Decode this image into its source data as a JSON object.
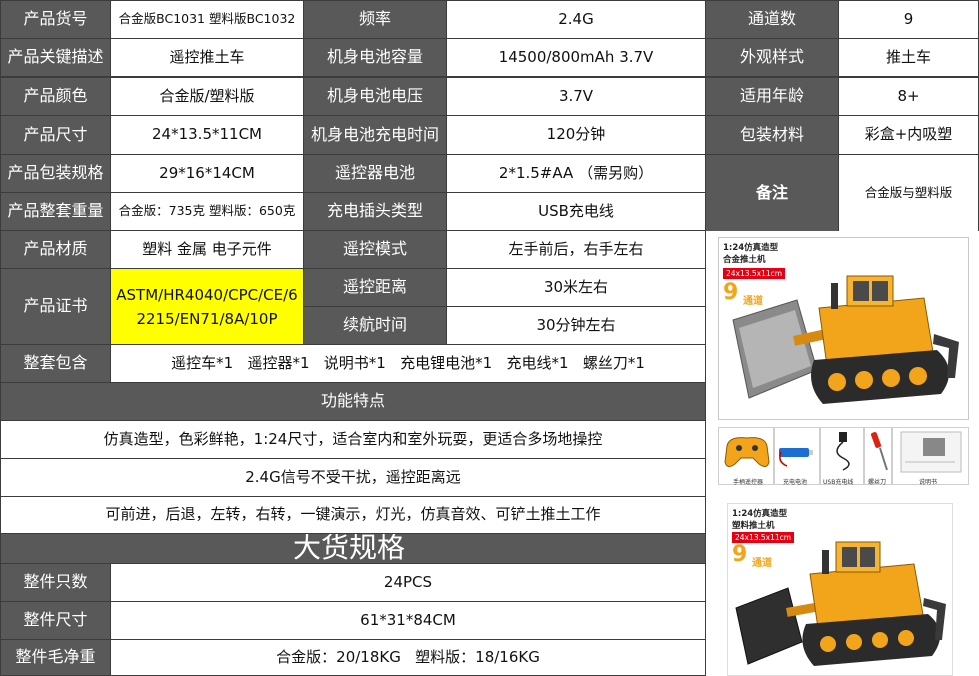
{
  "rows": {
    "r1": {
      "l1": "产品货号",
      "v1": "合金版BC1031  塑料版BC1032",
      "l2": "频率",
      "v2": "2.4G",
      "l3": "通道数",
      "v3": "9"
    },
    "r2": {
      "l1": "产品关键描述",
      "v1": "遥控推土车",
      "l2": "机身电池容量",
      "v2": "14500/800mAh 3.7V",
      "l3": "外观样式",
      "v3": "推土车"
    },
    "r3": {
      "l1": "产品颜色",
      "v1": "合金版/塑料版",
      "l2": "机身电池电压",
      "v2": "3.7V",
      "l3": "适用年龄",
      "v3": "8+"
    },
    "r4": {
      "l1": "产品尺寸",
      "v1": "24*13.5*11CM",
      "l2": "机身电池充电时间",
      "v2": "120分钟",
      "l3": "包装材料",
      "v3": "彩盒+内吸塑"
    },
    "r5": {
      "l1": "产品包装规格",
      "v1": "29*16*14CM",
      "l2": "遥控器电池",
      "v2": "2*1.5#AA （需另购）",
      "l3": "备注",
      "v3": "合金版与塑料版"
    },
    "r6": {
      "l1": "产品整套重量",
      "v1": "合金版：735克  塑料版：650克",
      "l2": "充电插头类型",
      "v2": "USB充电线"
    },
    "r7": {
      "l1": "产品材质",
      "v1": "塑料 金属 电子元件",
      "l2": "遥控模式",
      "v2": "左手前后，右手左右"
    },
    "r8": {
      "l1": "产品证书",
      "v1": "ASTM/HR4040/CPC/CE/62215/EN71/8A/10P",
      "l2": "遥控距离",
      "v2": "30米左右"
    },
    "r9": {
      "l2": "续航时间",
      "v2": "30分钟左右"
    },
    "r10": {
      "l1": "整套包含",
      "v1": "遥控车*1   遥控器*1   说明书*1   充电锂电池*1   充电线*1   螺丝刀*1"
    }
  },
  "features": {
    "title": "功能特点",
    "f1": "仿真造型，色彩鲜艳，1:24尺寸，适合室内和室外玩耍，更适合多场地操控",
    "f2": "2.4G信号不受干扰，遥控距离远",
    "f3": "可前进，后退，左转，右转，一键演示，灯光，仿真音效、可铲土推土工作"
  },
  "bulk": {
    "title": "大货规格",
    "qty_label": "整件只数",
    "qty": "24PCS",
    "size_label": "整件尺寸",
    "size": "61*31*84CM",
    "weight_label": "整件毛净重",
    "weight": "合金版：20/18KG   塑料版：18/16KG"
  },
  "images": {
    "alloy": {
      "title": "1:24仿真造型",
      "subtitle": "合金推土机",
      "dims": "24x13.5x11cm",
      "channel_num": "9",
      "channel_text": "通道"
    },
    "plastic": {
      "title": "1:24仿真造型",
      "subtitle": "塑料推土机",
      "dims": "24x13.5x11cm",
      "channel_num": "9",
      "channel_text": "通道"
    },
    "accessories": [
      "手柄遥控器",
      "充电电池",
      "USB充电线",
      "螺丝刀",
      "说明书"
    ]
  },
  "colors": {
    "label_bg": "#595959",
    "highlight": "#ffff00",
    "vehicle": "#f2a51a",
    "dims_tag": "#e60012"
  }
}
